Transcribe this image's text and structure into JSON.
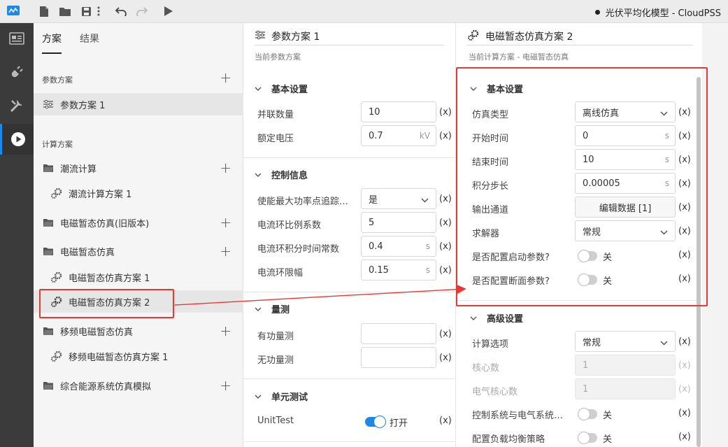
{
  "window": {
    "title": "光伏平均化模型 - CloudPSS"
  },
  "colors": {
    "accent": "#1e88e5",
    "highlight": "#e53935",
    "rail": "#3b3b3b"
  },
  "tree": {
    "tabs": [
      {
        "label": "方案"
      },
      {
        "label": "结果"
      }
    ],
    "param_section": "参数方案",
    "param_item": "参数方案 1",
    "calc_section": "计算方案",
    "items": [
      {
        "label": "潮流计算"
      },
      {
        "label": "潮流计算方案 1"
      },
      {
        "label": "电磁暂态仿真(旧版本)"
      },
      {
        "label": "电磁暂态仿真"
      },
      {
        "label": "电磁暂态仿真方案 1"
      },
      {
        "label": "电磁暂态仿真方案 2"
      },
      {
        "label": "移频电磁暂态仿真"
      },
      {
        "label": "移频电磁暂态仿真方案 1"
      },
      {
        "label": "综合能源系统仿真模拟"
      }
    ]
  },
  "mid": {
    "name": "参数方案 1",
    "subtitle": "当前参数方案",
    "basic": {
      "title": "基本设置",
      "rows": [
        {
          "label": "并联数量",
          "value": "10",
          "unit": ""
        },
        {
          "label": "额定电压",
          "value": "0.7",
          "unit": "kV"
        }
      ]
    },
    "control": {
      "title": "控制信息",
      "rows": [
        {
          "label": "使能最大功率点追踪…",
          "value": "是",
          "unit": ""
        },
        {
          "label": "电流环比例系数",
          "value": "5",
          "unit": ""
        },
        {
          "label": "电流环积分时间常数",
          "value": "0.4",
          "unit": "s"
        },
        {
          "label": "电流环限幅",
          "value": "0.15",
          "unit": "s"
        }
      ]
    },
    "measure": {
      "title": "量测",
      "rows": [
        {
          "label": "有功量测",
          "value": ""
        },
        {
          "label": "无功量测",
          "value": ""
        }
      ]
    },
    "unit_test": {
      "title": "单元测试",
      "label": "UnitTest",
      "state": "打开"
    }
  },
  "right": {
    "name": "电磁暂态仿真方案 2",
    "subtitle": "当前计算方案 - 电磁暂态仿真",
    "basic": {
      "title": "基本设置",
      "sim_type": {
        "label": "仿真类型",
        "value": "离线仿真"
      },
      "start": {
        "label": "开始时间",
        "value": "0",
        "unit": "s"
      },
      "end": {
        "label": "结束时间",
        "value": "10",
        "unit": "s"
      },
      "step": {
        "label": "积分步长",
        "value": "0.00005",
        "unit": "s"
      },
      "output": {
        "label": "输出通道",
        "value": "编辑数据 [1]"
      },
      "solver": {
        "label": "求解器",
        "value": "常规"
      },
      "start_param": {
        "label": "是否配置启动参数?",
        "state": "关"
      },
      "snapshot_param": {
        "label": "是否配置断面参数?",
        "state": "关"
      }
    },
    "advanced": {
      "title": "高级设置",
      "calc_option": {
        "label": "计算选项",
        "value": "常规"
      },
      "cores": {
        "label": "核心数",
        "value": "1"
      },
      "elec_cores": {
        "label": "电气核心数",
        "value": "1"
      },
      "ctrl_elec": {
        "label": "控制系统与电气系统…",
        "state": "关"
      },
      "load_balance": {
        "label": "配置负载均衡策略",
        "state": "关"
      }
    }
  },
  "xlabel": "(x)"
}
